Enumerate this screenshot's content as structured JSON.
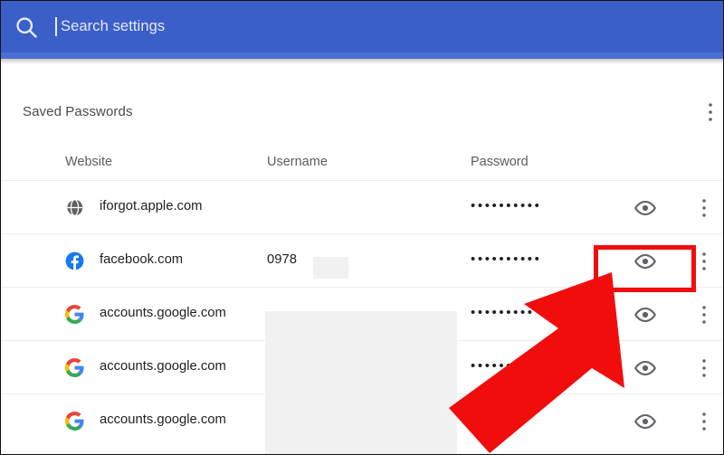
{
  "search": {
    "placeholder": "Search settings",
    "icon": "search-icon",
    "bar_color": "#3a5fc8",
    "has_caret": true
  },
  "section": {
    "title": "Saved Passwords",
    "more_icon": "kebab-menu-icon"
  },
  "table": {
    "columns": [
      "Website",
      "Username",
      "Password"
    ],
    "rows": [
      {
        "favicon": "globe-icon",
        "website": "iforgot.apple.com",
        "username": "",
        "password": "••••••••••",
        "eye_icon": "eye-icon",
        "menu_icon": "kebab-menu-icon"
      },
      {
        "favicon": "facebook-icon",
        "website": "facebook.com",
        "username": "0978",
        "password": "••••••••••",
        "eye_icon": "eye-icon",
        "menu_icon": "kebab-menu-icon"
      },
      {
        "favicon": "google-icon",
        "website": "accounts.google.com",
        "username": "",
        "password": "•••••••••",
        "eye_icon": "eye-icon",
        "menu_icon": "kebab-menu-icon"
      },
      {
        "favicon": "google-icon",
        "website": "accounts.google.com",
        "username": "",
        "password": "••••••",
        "eye_icon": "eye-icon",
        "menu_icon": "kebab-menu-icon"
      },
      {
        "favicon": "google-icon",
        "website": "accounts.google.com",
        "username": "",
        "password": "••••• ••",
        "eye_icon": "eye-icon",
        "menu_icon": "kebab-menu-icon"
      }
    ]
  },
  "annotations": {
    "highlight_color": "#f20d0d",
    "arrow_color": "#f20d0d",
    "arrow_icon": "arrow-pointing-up-right",
    "highlight_target": "show-password-eye-button-row-2"
  }
}
